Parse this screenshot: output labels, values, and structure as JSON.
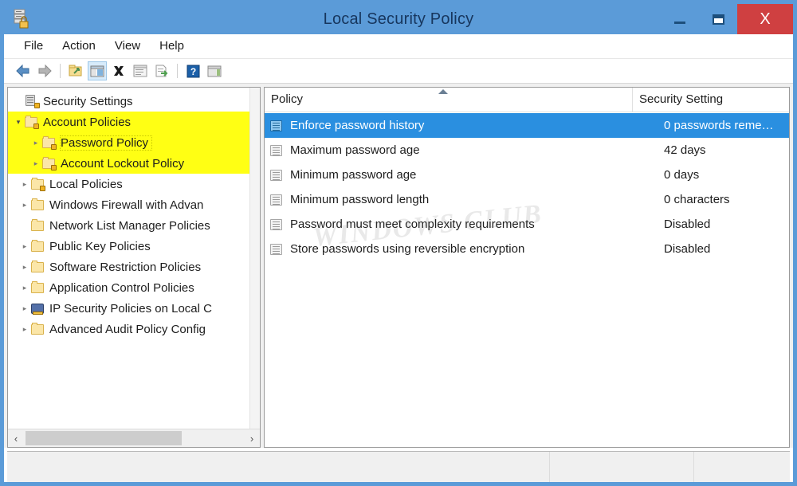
{
  "window": {
    "title": "Local Security Policy",
    "icon": "security-policy-icon",
    "accent_color": "#5b9bd8",
    "title_text_color": "#17365d",
    "close_button_color": "#cf4041",
    "selection_color": "#2a8fe0",
    "highlight_color": "#ffff14",
    "buttons": {
      "minimize": "minimize",
      "maximize": "restore",
      "close": "X"
    }
  },
  "menubar": {
    "items": [
      {
        "label": "File"
      },
      {
        "label": "Action"
      },
      {
        "label": "View"
      },
      {
        "label": "Help"
      }
    ]
  },
  "toolbar": {
    "items": [
      {
        "name": "back-icon",
        "glyph": "◀",
        "color": "#4a7fb5",
        "active": false
      },
      {
        "name": "forward-icon",
        "glyph": "▶",
        "color": "#9a9a9a",
        "active": false
      },
      {
        "name": "separator",
        "glyph": "",
        "color": "",
        "active": false
      },
      {
        "name": "up-folder-icon",
        "glyph": "",
        "color": "#e8c55a",
        "active": false
      },
      {
        "name": "show-hide-console-tree-icon",
        "glyph": "",
        "color": "#7ea9cf",
        "active": true
      },
      {
        "name": "delete-icon",
        "glyph": "✖",
        "color": "#1a1a1a",
        "active": false
      },
      {
        "name": "properties-icon",
        "glyph": "",
        "color": "#a8a8a8",
        "active": false
      },
      {
        "name": "export-list-icon",
        "glyph": "",
        "color": "#8ab87a",
        "active": false
      },
      {
        "name": "separator",
        "glyph": "",
        "color": "",
        "active": false
      },
      {
        "name": "help-icon",
        "glyph": "?",
        "color": "#1b5fa8",
        "active": false
      },
      {
        "name": "show-action-pane-icon",
        "glyph": "",
        "color": "#90a878",
        "active": false
      }
    ]
  },
  "tree": {
    "items": [
      {
        "label": "Security Settings",
        "indent": 0,
        "twisty": "none",
        "icon": "security-settings-icon",
        "highlight": false,
        "focus": false
      },
      {
        "label": "Account Policies",
        "indent": 1,
        "twisty": "expanded",
        "icon": "folder-lock-icon",
        "highlight": true,
        "focus": false
      },
      {
        "label": "Password Policy",
        "indent": 2,
        "twisty": "collapsed",
        "icon": "folder-lock-icon",
        "highlight": true,
        "focus": true
      },
      {
        "label": "Account Lockout Policy",
        "indent": 2,
        "twisty": "collapsed",
        "icon": "folder-lock-icon",
        "highlight": true,
        "focus": false
      },
      {
        "label": "Local Policies",
        "indent": 1,
        "twisty": "collapsed",
        "icon": "folder-lock-icon",
        "highlight": false,
        "focus": false
      },
      {
        "label": "Windows Firewall with Advan",
        "indent": 1,
        "twisty": "collapsed",
        "icon": "folder-icon",
        "highlight": false,
        "focus": false
      },
      {
        "label": "Network List Manager Policies",
        "indent": 1,
        "twisty": "none",
        "icon": "folder-icon",
        "highlight": false,
        "focus": false
      },
      {
        "label": "Public Key Policies",
        "indent": 1,
        "twisty": "collapsed",
        "icon": "folder-icon",
        "highlight": false,
        "focus": false
      },
      {
        "label": "Software Restriction Policies",
        "indent": 1,
        "twisty": "collapsed",
        "icon": "folder-icon",
        "highlight": false,
        "focus": false
      },
      {
        "label": "Application Control Policies",
        "indent": 1,
        "twisty": "collapsed",
        "icon": "folder-icon",
        "highlight": false,
        "focus": false
      },
      {
        "label": "IP Security Policies on Local C",
        "indent": 1,
        "twisty": "collapsed",
        "icon": "ip-security-icon",
        "highlight": false,
        "focus": false
      },
      {
        "label": "Advanced Audit Policy Config",
        "indent": 1,
        "twisty": "collapsed",
        "icon": "folder-icon",
        "highlight": false,
        "focus": false
      }
    ],
    "hscroll": {
      "left_arrow": "‹",
      "right_arrow": "›"
    }
  },
  "list": {
    "columns": [
      {
        "label": "Policy",
        "sorted": "asc"
      },
      {
        "label": "Security Setting",
        "sorted": "none"
      }
    ],
    "rows": [
      {
        "policy": "Enforce password history",
        "setting": "0 passwords reme…",
        "selected": true
      },
      {
        "policy": "Maximum password age",
        "setting": "42 days",
        "selected": false
      },
      {
        "policy": "Minimum password age",
        "setting": "0 days",
        "selected": false
      },
      {
        "policy": "Minimum password length",
        "setting": "0 characters",
        "selected": false
      },
      {
        "policy": "Password must meet complexity requirements",
        "setting": "Disabled",
        "selected": false
      },
      {
        "policy": "Store passwords using reversible encryption",
        "setting": "Disabled",
        "selected": false
      }
    ],
    "watermark": "WINDOWS CLUB"
  },
  "statusbar": {
    "main": "",
    "panel_b": "",
    "panel_c": ""
  }
}
